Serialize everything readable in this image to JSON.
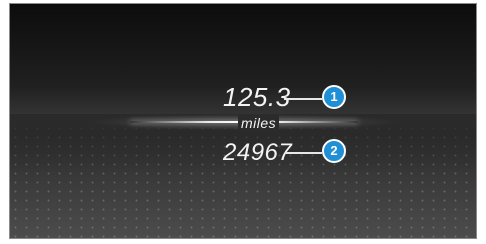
{
  "display": {
    "trip_distance": "125.3",
    "unit": "miles",
    "odometer": "24967"
  },
  "callouts": [
    {
      "label": "1"
    },
    {
      "label": "2"
    }
  ],
  "colors": {
    "callout_fill": "#1f8fd6",
    "text": "#f4f4f4"
  }
}
